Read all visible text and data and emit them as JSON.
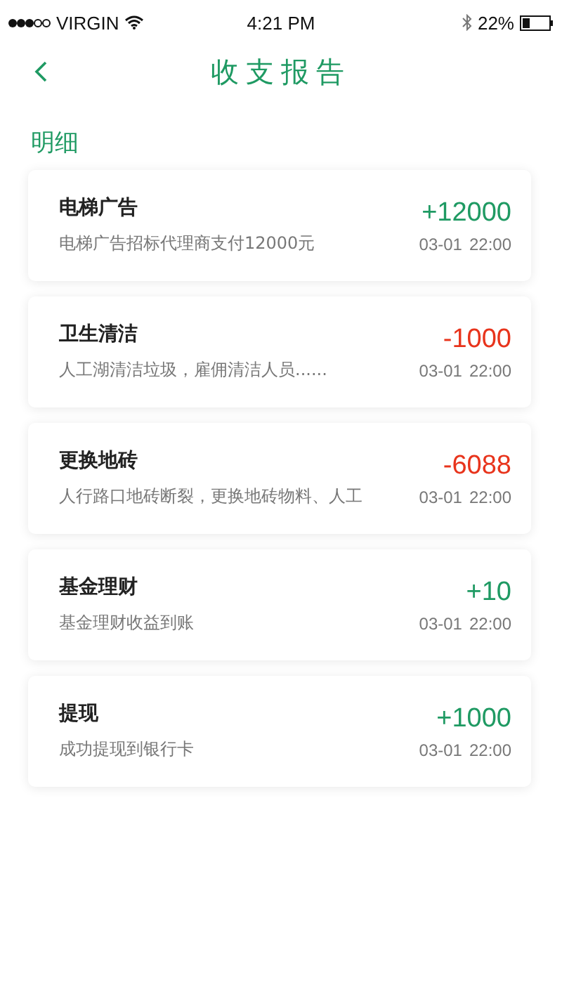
{
  "status_bar": {
    "carrier": "VIRGIN",
    "time": "4:21 PM",
    "battery": "22%"
  },
  "header": {
    "title": "收支报告"
  },
  "section": {
    "title": "明细"
  },
  "records": [
    {
      "title": "电梯广告",
      "description": "电梯广告招标代理商支付12000元",
      "amount": "+12000",
      "kind": "income",
      "date": "03-01",
      "time": "22:00"
    },
    {
      "title": "卫生清洁",
      "description": "人工湖清洁垃圾，雇佣清洁人员......",
      "amount": "-1000",
      "kind": "expense",
      "date": "03-01",
      "time": "22:00"
    },
    {
      "title": "更换地砖",
      "description": "人行路口地砖断裂，更换地砖物料、人工",
      "amount": "-6088",
      "kind": "expense",
      "date": "03-01",
      "time": "22:00"
    },
    {
      "title": "基金理财",
      "description": "基金理财收益到账",
      "amount": "+10",
      "kind": "income",
      "date": "03-01",
      "time": "22:00"
    },
    {
      "title": "提现",
      "description": "成功提现到银行卡",
      "amount": "+1000",
      "kind": "income",
      "date": "03-01",
      "time": "22:00"
    }
  ]
}
